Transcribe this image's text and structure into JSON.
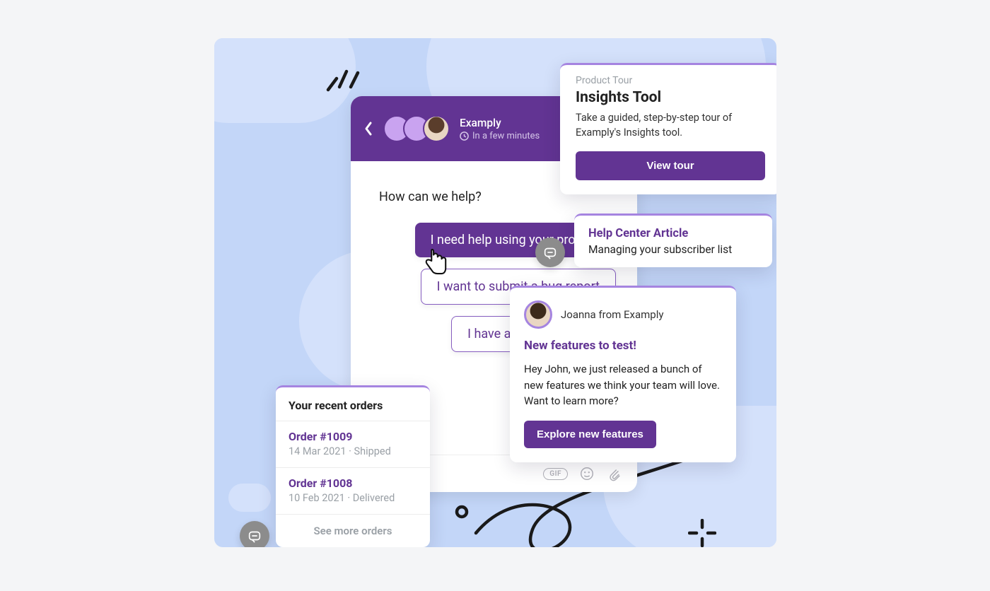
{
  "chat": {
    "brand": "Examply",
    "response_time": "In a few minutes",
    "prompt": "How can we help?",
    "choices": [
      "I need help using your product",
      "I want to submit a bug report",
      "I have another question"
    ],
    "footer_gif_label": "GIF"
  },
  "tour": {
    "eyebrow": "Product Tour",
    "title": "Insights Tool",
    "description": "Take a guided, step-by-step tour of Examply's Insights tool.",
    "cta": "View tour"
  },
  "help_center": {
    "title": "Help Center Article",
    "subtitle": "Managing your subscriber list"
  },
  "announcement": {
    "from": "Joanna from Examply",
    "title": "New features to test!",
    "body": "Hey John, we just released a bunch of new features we think your team will love. Want to learn more?",
    "cta": "Explore new features"
  },
  "orders": {
    "title": "Your recent orders",
    "items": [
      {
        "label": "Order #1009",
        "meta": "14 Mar 2021 · Shipped"
      },
      {
        "label": "Order #1008",
        "meta": "10 Feb 2021 · Delivered"
      }
    ],
    "more": "See more orders"
  }
}
